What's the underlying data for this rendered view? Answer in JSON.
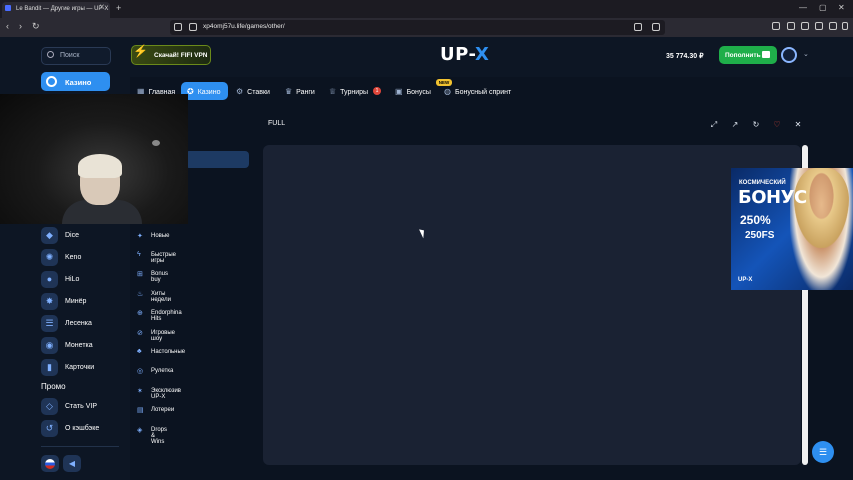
{
  "browser": {
    "tab_title": "Le Bandit — Другие игры — UP-X",
    "url": "xp4omj57u.life/games/other/"
  },
  "sidebar": {
    "search_label": "Поиск",
    "casino_label": "Казино",
    "games": [
      {
        "label": "Dice",
        "icon": "dice-icon"
      },
      {
        "label": "Keno",
        "icon": "keno-icon"
      },
      {
        "label": "HiLo",
        "icon": "hilo-icon"
      },
      {
        "label": "Минёр",
        "icon": "mines-icon"
      },
      {
        "label": "Лесенка",
        "icon": "ladder-icon"
      },
      {
        "label": "Монетка",
        "icon": "coin-icon"
      },
      {
        "label": "Карточки",
        "icon": "cards-icon"
      }
    ],
    "promo_heading": "Промо",
    "promo_items": [
      {
        "label": "Стать VIP",
        "icon": "diamond-icon"
      },
      {
        "label": "О кэшбэке",
        "icon": "cashback-icon"
      }
    ]
  },
  "header": {
    "vpn_label": "Скачай! FIFI VPN",
    "logo_main": "UP-",
    "logo_accent": "X",
    "balance": "35 774.30 ₽",
    "deposit_label": "Пополнить"
  },
  "nav": {
    "items": [
      {
        "label": "Главная",
        "icon": "home-icon"
      },
      {
        "label": "Казино",
        "icon": "casino-icon"
      },
      {
        "label": "Ставки",
        "icon": "bets-icon"
      },
      {
        "label": "Ранги",
        "icon": "ranks-icon"
      },
      {
        "label": "Турниры",
        "icon": "trophy-icon"
      },
      {
        "label": "Бонусы",
        "icon": "gift-icon"
      },
      {
        "label": "Бонусный спринт",
        "icon": "sprint-icon"
      }
    ],
    "tournament_badge": "1",
    "new_badge": "NEW"
  },
  "categories": [
    {
      "label": "Новые"
    },
    {
      "label": "Быстрые игры"
    },
    {
      "label": "Bonus buy"
    },
    {
      "label": "Хиты недели"
    },
    {
      "label": "Endorphina Hits"
    },
    {
      "label": "Игровые шоу"
    },
    {
      "label": "Настольные"
    },
    {
      "label": "Рулетка"
    },
    {
      "label": "Эксклюзив UP-X"
    },
    {
      "label": "Лотереи"
    },
    {
      "label": "Drops & Wins"
    }
  ],
  "game": {
    "mode_label": "FULL"
  },
  "promo_banner": {
    "line1": "КОСМИЧЕСКИЙ",
    "line2": "БОНУС",
    "line3": "250%",
    "line4": "250FS",
    "logo": "UP-X"
  },
  "colors": {
    "accent": "#2e8ff0",
    "deposit": "#1fae4a",
    "background": "#0b1320"
  }
}
